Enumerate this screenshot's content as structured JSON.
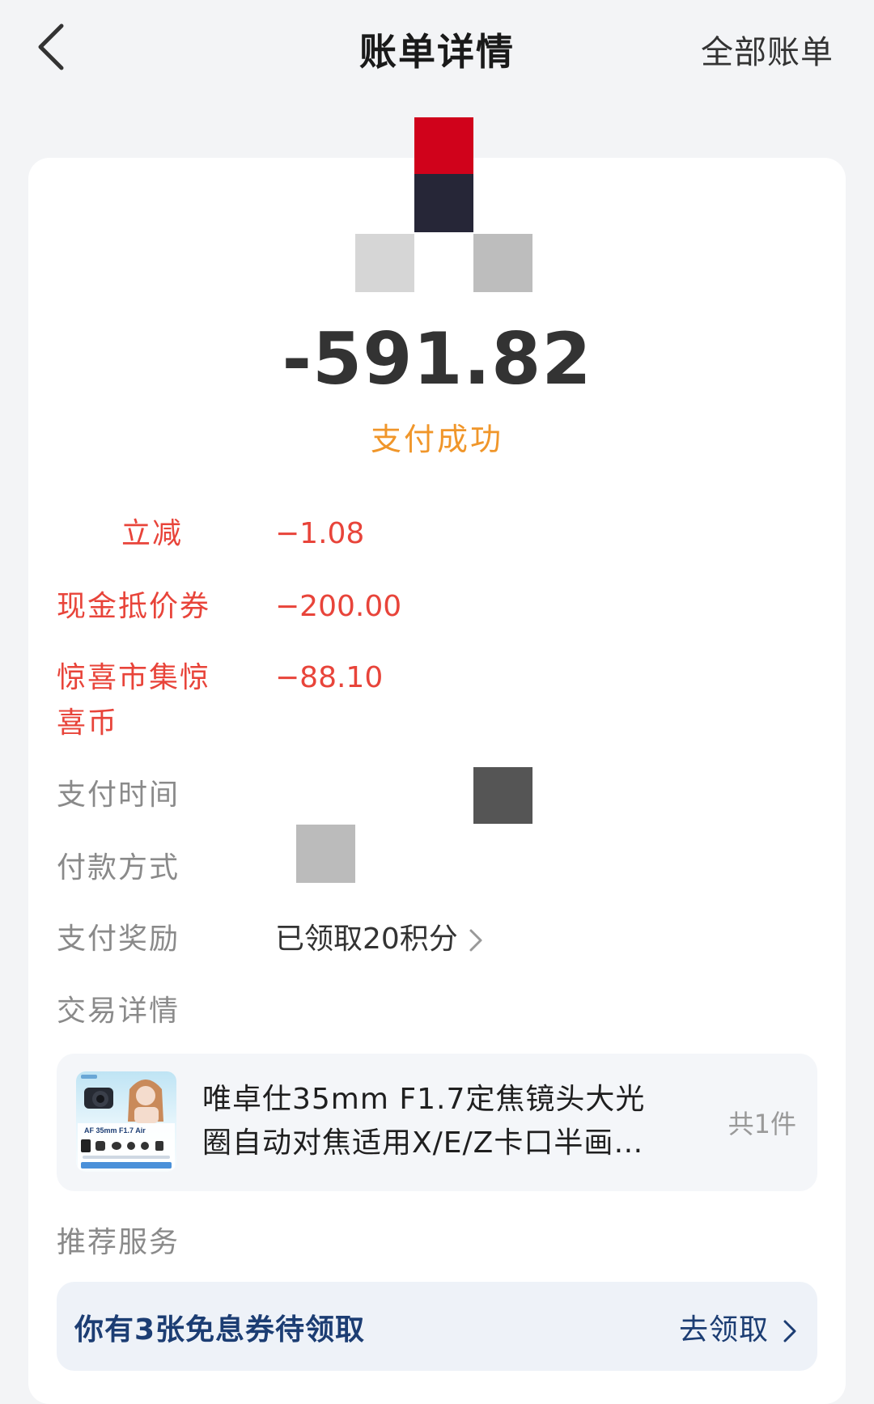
{
  "header": {
    "title": "账单详情",
    "right_link": "全部账单"
  },
  "summary": {
    "amount": "-591.82",
    "status": "支付成功",
    "status_color": "#f0962a"
  },
  "details": [
    {
      "label": "立减",
      "value": "−1.08"
    },
    {
      "label": "现金抵价券",
      "value": "−200.00"
    },
    {
      "label": "惊喜市集惊喜币",
      "value": "−88.10"
    },
    {
      "label": "支付时间",
      "value": ""
    },
    {
      "label": "付款方式",
      "value": ""
    },
    {
      "label": "支付奖励",
      "value": "已领取20积分"
    },
    {
      "label": "交易详情",
      "value": ""
    }
  ],
  "product": {
    "name": "唯卓仕35mm F1.7定焦镜头大光圈自动对焦适用X/E/Z卡口半画…",
    "count": "共1件",
    "thumb_caption": "AF 35mm F1.7 Air"
  },
  "recommend": {
    "title": "推荐服务",
    "promo_text": "你有3张免息券待领取",
    "promo_action": "去领取"
  },
  "colors": {
    "accent_red": "#e8443a",
    "accent_blue": "#1c3d73"
  }
}
